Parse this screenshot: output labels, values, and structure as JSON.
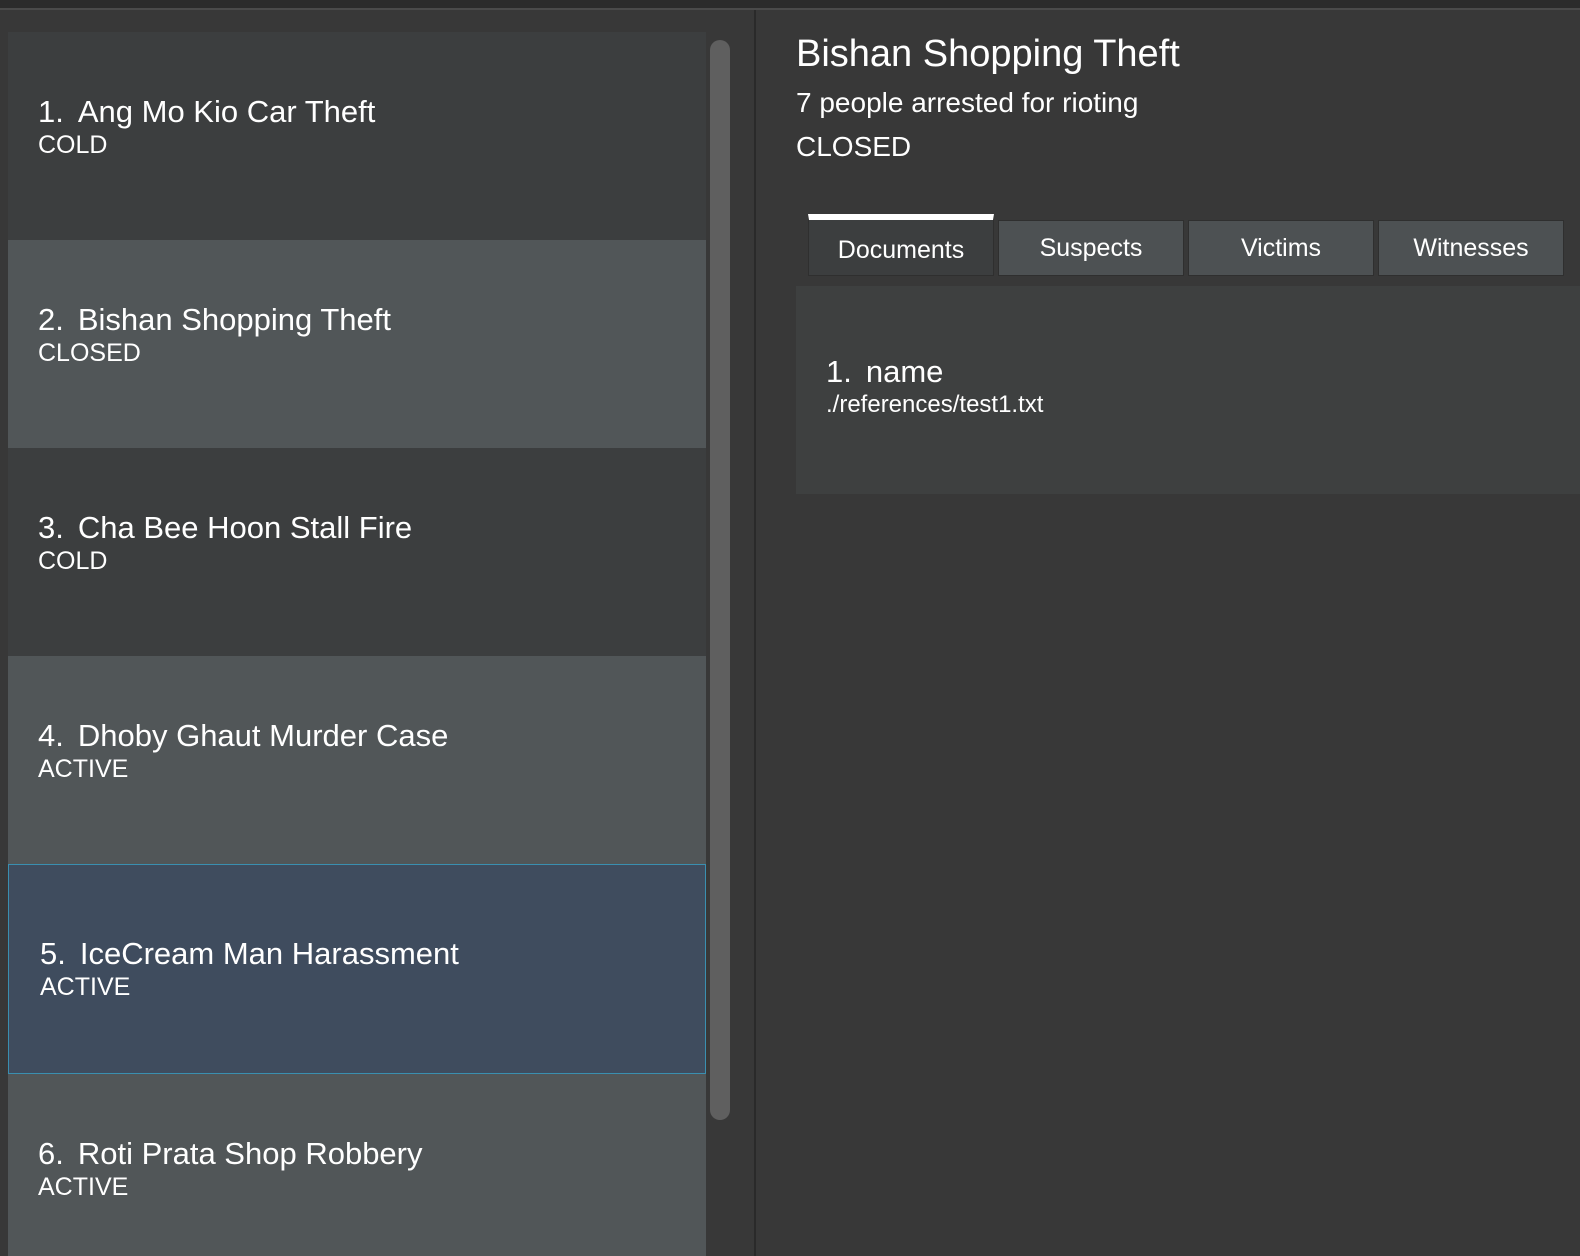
{
  "cases": [
    {
      "index": "1.",
      "title": "Ang Mo Kio Car Theft",
      "status": "COLD"
    },
    {
      "index": "2.",
      "title": "Bishan Shopping Theft",
      "status": "CLOSED"
    },
    {
      "index": "3.",
      "title": "Cha Bee Hoon Stall Fire",
      "status": "COLD"
    },
    {
      "index": "4.",
      "title": "Dhoby Ghaut Murder Case",
      "status": "ACTIVE"
    },
    {
      "index": "5.",
      "title": "IceCream Man Harassment",
      "status": "ACTIVE"
    },
    {
      "index": "6.",
      "title": "Roti Prata Shop Robbery",
      "status": "ACTIVE"
    }
  ],
  "detail": {
    "title": "Bishan Shopping Theft",
    "description": "7 people arrested for rioting",
    "status": "CLOSED",
    "tabs": [
      "Documents",
      "Suspects",
      "Victims",
      "Witnesses"
    ],
    "active_tab": "Documents",
    "documents": [
      {
        "index": "1.",
        "name": "name",
        "path": "./references/test1.txt"
      }
    ]
  },
  "colors": {
    "background": "#383838",
    "card_dark": "#3c3e3f",
    "card_light": "#515658",
    "card_selected": "#3f4c5e",
    "selected_border": "#3a8fb0"
  }
}
